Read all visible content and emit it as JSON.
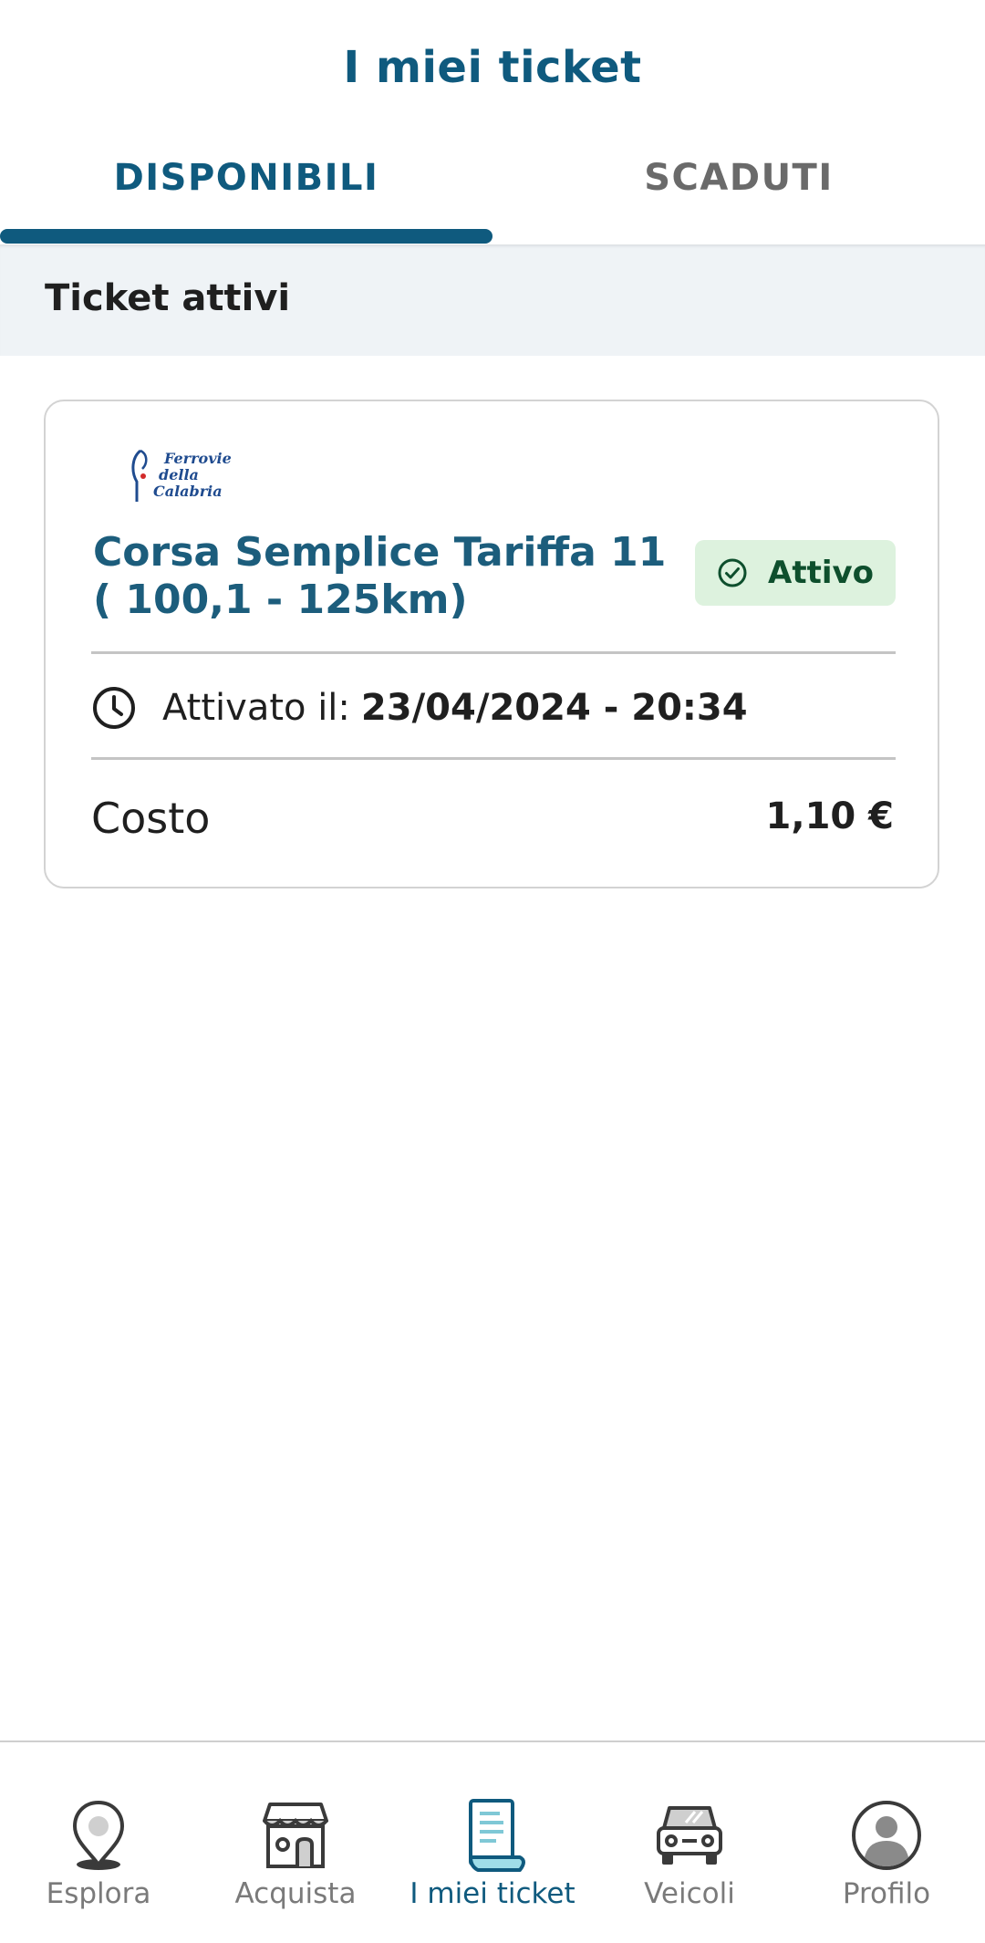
{
  "header": {
    "title": "I miei ticket"
  },
  "tabs": [
    {
      "label": "DISPONIBILI",
      "active": true
    },
    {
      "label": "SCADUTI",
      "active": false
    }
  ],
  "section": {
    "title": "Ticket attivi"
  },
  "ticket": {
    "operator_logo_text": [
      "Ferrovie",
      "della",
      "Calabria"
    ],
    "name": "Corsa Semplice Tariffa 11 ( 100,1 - 125km)",
    "status": "Attivo",
    "activation_label": "Attivato il:",
    "activation_value": "23/04/2024 - 20:34",
    "cost_label": "Costo",
    "cost_value": "1,10 €"
  },
  "bottom_nav": {
    "items": [
      {
        "label": "Esplora",
        "icon": "map-pin-icon",
        "active": false
      },
      {
        "label": "Acquista",
        "icon": "store-icon",
        "active": false
      },
      {
        "label": "I miei ticket",
        "icon": "ticket-receipt-icon",
        "active": true
      },
      {
        "label": "Veicoli",
        "icon": "car-icon",
        "active": false
      },
      {
        "label": "Profilo",
        "icon": "profile-icon",
        "active": false
      }
    ]
  },
  "colors": {
    "primary": "#0f5a7e",
    "badge_bg": "#ddf2de",
    "badge_text": "#0e4f2d",
    "section_bg": "#eff3f6"
  }
}
